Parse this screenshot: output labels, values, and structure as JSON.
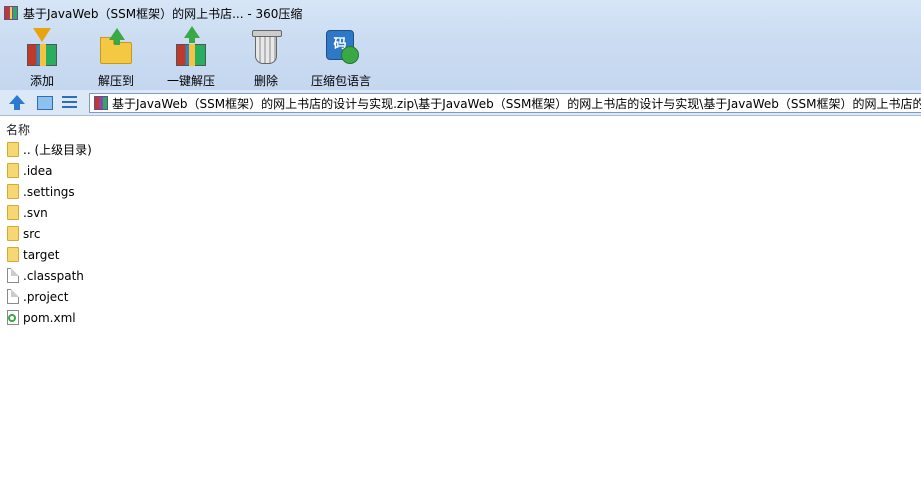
{
  "window": {
    "title": "基于JavaWeb（SSM框架）的网上书店... - 360压缩"
  },
  "toolbar": {
    "buttons": [
      {
        "label": "添加",
        "icon": "add-archive-icon"
      },
      {
        "label": "解压到",
        "icon": "extract-to-icon"
      },
      {
        "label": "一键解压",
        "icon": "one-click-extract-icon"
      },
      {
        "label": "删除",
        "icon": "delete-icon"
      },
      {
        "label": "压缩包语言",
        "icon": "archive-language-icon",
        "glyph": "码"
      }
    ]
  },
  "navbar": {
    "path": "基于JavaWeb（SSM框架）的网上书店的设计与实现.zip\\基于JavaWeb（SSM框架）的网上书店的设计与实现\\基于JavaWeb（SSM框架）的网上书店的设计与实现"
  },
  "list": {
    "column_name": "名称",
    "items": [
      {
        "name": ".. (上级目录)",
        "type": "folder"
      },
      {
        "name": ".idea",
        "type": "folder"
      },
      {
        "name": ".settings",
        "type": "folder"
      },
      {
        "name": ".svn",
        "type": "folder"
      },
      {
        "name": "src",
        "type": "folder"
      },
      {
        "name": "target",
        "type": "folder"
      },
      {
        "name": ".classpath",
        "type": "file"
      },
      {
        "name": ".project",
        "type": "file"
      },
      {
        "name": "pom.xml",
        "type": "xml"
      }
    ]
  }
}
